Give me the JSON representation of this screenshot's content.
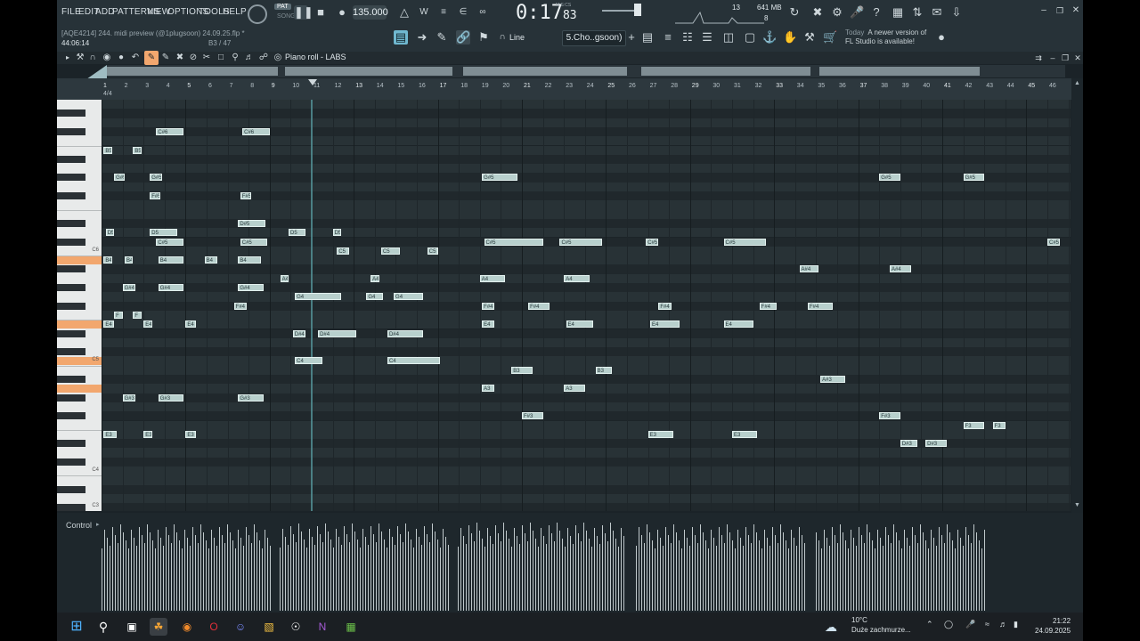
{
  "menu": {
    "file": "FILE",
    "edit": "EDIT",
    "add": "ADD",
    "patterns": "PATTERNS",
    "view": "VIEW",
    "options": "OPTIONS",
    "tools": "TOOLS",
    "help": "HELP"
  },
  "project": {
    "info_line": "[AQE4214] 244. midi preview (@1plugsoon) 24.09.25.flp *",
    "position": "44:06:14",
    "note_hint": "B3 / 47"
  },
  "transport": {
    "pat": "PAT",
    "song": "SONG",
    "tempo": "135.000",
    "time_main": "0:17",
    "time_cs": "83",
    "time_unit": "M:S:CS"
  },
  "system": {
    "cpu_num": "13",
    "memory": "641 MB",
    "voices": "8"
  },
  "toolbar2": {
    "snap_mode": "Line",
    "pattern_name": "5.Cho..gsoon)",
    "news_day": "Today",
    "news_text": "A newer version of FL Studio is available!"
  },
  "pianoroll": {
    "title": "Piano roll - LABS",
    "time_sig": "4/4",
    "octave_labels": [
      "C6",
      "C5",
      "C4",
      "C3"
    ],
    "ruler": [
      "1",
      "2",
      "3",
      "4",
      "5",
      "6",
      "7",
      "8",
      "9",
      "10",
      "11",
      "12",
      "13",
      "14",
      "15",
      "16",
      "17",
      "18",
      "19",
      "20",
      "21",
      "22",
      "23",
      "24",
      "25",
      "26",
      "27",
      "28",
      "29",
      "30",
      "31",
      "32",
      "33",
      "34",
      "35",
      "36",
      "37",
      "38",
      "39",
      "40",
      "41",
      "42",
      "43",
      "44",
      "45",
      "46"
    ],
    "notes": [
      {
        "p": "C#6",
        "b": 2.6,
        "l": 1.3
      },
      {
        "p": "C#6",
        "b": 6.7,
        "l": 1.3
      },
      {
        "p": "B5",
        "b": 0.1,
        "l": 0.4
      },
      {
        "p": "B5",
        "b": 1.5,
        "l": 0.4
      },
      {
        "p": "G#5",
        "b": 0.6,
        "l": 0.5
      },
      {
        "p": "G#5",
        "b": 2.3,
        "l": 0.6
      },
      {
        "p": "F#5",
        "b": 2.3,
        "l": 0.5
      },
      {
        "p": "F#5",
        "b": 6.6,
        "l": 0.5
      },
      {
        "p": "D5",
        "b": 0.2,
        "l": 0.4
      },
      {
        "p": "D5",
        "b": 2.3,
        "l": 1.3
      },
      {
        "p": "D#5",
        "b": 6.5,
        "l": 1.3
      },
      {
        "p": "D5",
        "b": 8.9,
        "l": 0.8
      },
      {
        "p": "D5",
        "b": 11.0,
        "l": 0.4
      },
      {
        "p": "C#5",
        "b": 2.6,
        "l": 1.3
      },
      {
        "p": "C#5",
        "b": 6.6,
        "l": 1.3
      },
      {
        "p": "C5",
        "b": 11.2,
        "l": 0.6
      },
      {
        "p": "C5",
        "b": 13.3,
        "l": 0.9
      },
      {
        "p": "C5",
        "b": 15.5,
        "l": 0.5
      },
      {
        "p": "B4",
        "b": 0.1,
        "l": 0.4
      },
      {
        "p": "B4",
        "b": 1.1,
        "l": 0.4
      },
      {
        "p": "B4",
        "b": 2.7,
        "l": 1.2
      },
      {
        "p": "B4",
        "b": 4.9,
        "l": 0.6
      },
      {
        "p": "B4",
        "b": 6.5,
        "l": 1.1
      },
      {
        "p": "A4",
        "b": 8.5,
        "l": 0.4
      },
      {
        "p": "A4",
        "b": 12.8,
        "l": 0.4
      },
      {
        "p": "G#4",
        "b": 1.0,
        "l": 0.6
      },
      {
        "p": "G#4",
        "b": 2.7,
        "l": 1.2
      },
      {
        "p": "G#4",
        "b": 6.5,
        "l": 1.2
      },
      {
        "p": "G4",
        "b": 9.2,
        "l": 2.2
      },
      {
        "p": "G4",
        "b": 12.6,
        "l": 0.8
      },
      {
        "p": "G4",
        "b": 13.9,
        "l": 1.4
      },
      {
        "p": "F",
        "b": 0.6,
        "l": 0.4
      },
      {
        "p": "F",
        "b": 1.5,
        "l": 0.4
      },
      {
        "p": "F#4",
        "b": 6.3,
        "l": 0.6
      },
      {
        "p": "E4",
        "b": 0.1,
        "l": 0.5
      },
      {
        "p": "E4",
        "b": 2.0,
        "l": 0.4
      },
      {
        "p": "E4",
        "b": 4.0,
        "l": 0.5
      },
      {
        "p": "D#4",
        "b": 9.1,
        "l": 0.6
      },
      {
        "p": "D#4",
        "b": 10.3,
        "l": 1.8
      },
      {
        "p": "D#4",
        "b": 13.6,
        "l": 1.7
      },
      {
        "p": "C4",
        "b": 9.2,
        "l": 1.3
      },
      {
        "p": "C4",
        "b": 13.6,
        "l": 2.5
      },
      {
        "p": "G#3",
        "b": 1.0,
        "l": 0.6
      },
      {
        "p": "G#3",
        "b": 2.7,
        "l": 1.2
      },
      {
        "p": "G#3",
        "b": 6.5,
        "l": 1.2
      },
      {
        "p": "E3",
        "b": 0.1,
        "l": 0.6
      },
      {
        "p": "E3",
        "b": 2.0,
        "l": 0.4
      },
      {
        "p": "E3",
        "b": 4.0,
        "l": 0.5
      },
      {
        "p": "G#5",
        "b": 18.1,
        "l": 1.7
      },
      {
        "p": "G#5",
        "b": 37.0,
        "l": 1.0
      },
      {
        "p": "G#5",
        "b": 41.0,
        "l": 1.0
      },
      {
        "p": "C#5",
        "b": 18.2,
        "l": 2.8
      },
      {
        "p": "C#5",
        "b": 21.8,
        "l": 2.0
      },
      {
        "p": "C#5",
        "b": 25.9,
        "l": 0.6
      },
      {
        "p": "C#5",
        "b": 29.6,
        "l": 2.0
      },
      {
        "p": "C#5",
        "b": 45.0,
        "l": 0.6
      },
      {
        "p": "A4",
        "b": 18.0,
        "l": 1.2
      },
      {
        "p": "A4",
        "b": 22.0,
        "l": 1.2
      },
      {
        "p": "A#4",
        "b": 33.2,
        "l": 0.9
      },
      {
        "p": "A#4",
        "b": 37.5,
        "l": 1.0
      },
      {
        "p": "F#4",
        "b": 18.1,
        "l": 0.6
      },
      {
        "p": "F#4",
        "b": 20.3,
        "l": 1.0
      },
      {
        "p": "F#4",
        "b": 26.5,
        "l": 0.6
      },
      {
        "p": "F#4",
        "b": 31.3,
        "l": 0.8
      },
      {
        "p": "F#4",
        "b": 33.6,
        "l": 1.2
      },
      {
        "p": "E4",
        "b": 18.1,
        "l": 0.6
      },
      {
        "p": "E4",
        "b": 22.1,
        "l": 1.3
      },
      {
        "p": "E4",
        "b": 26.1,
        "l": 1.4
      },
      {
        "p": "E4",
        "b": 29.6,
        "l": 1.4
      },
      {
        "p": "B3",
        "b": 19.5,
        "l": 1.0
      },
      {
        "p": "B3",
        "b": 23.5,
        "l": 0.8
      },
      {
        "p": "A3",
        "b": 18.1,
        "l": 0.6
      },
      {
        "p": "A3",
        "b": 22.0,
        "l": 1.0
      },
      {
        "p": "A#3",
        "b": 34.2,
        "l": 1.2
      },
      {
        "p": "F#3",
        "b": 20.0,
        "l": 1.0
      },
      {
        "p": "F#3",
        "b": 37.0,
        "l": 1.0
      },
      {
        "p": "E3",
        "b": 26.0,
        "l": 1.2
      },
      {
        "p": "E3",
        "b": 30.0,
        "l": 1.2
      },
      {
        "p": "F3",
        "b": 41.0,
        "l": 1.0
      },
      {
        "p": "F3",
        "b": 42.4,
        "l": 0.6
      },
      {
        "p": "D#3",
        "b": 38.0,
        "l": 0.8
      },
      {
        "p": "D#3",
        "b": 39.2,
        "l": 1.0
      }
    ]
  },
  "control": {
    "label": "Control"
  },
  "taskbar": {
    "temp": "10°C",
    "weather_desc": "Duże zachmurze...",
    "time": "21:22",
    "date": "24.09.2025"
  }
}
